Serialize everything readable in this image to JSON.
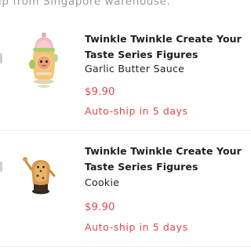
{
  "header": {
    "note": "ip from Singapore warehouse."
  },
  "items": [
    {
      "title": "Twinkle Twinkle Create Your Taste Series Figures",
      "variant": "Garlic Butter Sauce",
      "price": "$9.90",
      "autoship": "Auto-ship in 5 days",
      "image_icon": "garlic-butter-sauce-figure-icon"
    },
    {
      "title": "Twinkle Twinkle Create Your Taste Series Figures",
      "variant": "Cookie",
      "price": "$9.90",
      "autoship": "Auto-ship in 5 days",
      "image_icon": "cookie-figure-icon"
    }
  ],
  "colors": {
    "price": "#e0474c",
    "title": "#1f1f1f",
    "muted": "#9a9a9a"
  }
}
